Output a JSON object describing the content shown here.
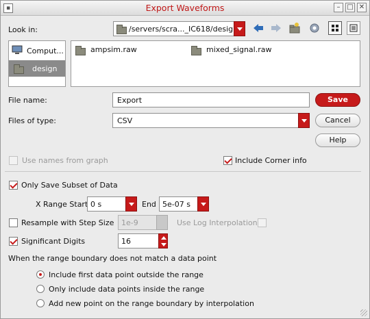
{
  "window": {
    "title": "Export Waveforms",
    "controls": [
      "minimize-icon",
      "maximize-icon",
      "close-icon"
    ]
  },
  "look_in": {
    "label": "Look in:",
    "value": "/servers/scra..._IC618/design"
  },
  "toolbar": {
    "icons": [
      "back-arrow-icon",
      "forward-arrow-icon",
      "new-folder-icon",
      "home-icon",
      "list-view-icon",
      "detail-view-icon"
    ]
  },
  "places": [
    {
      "label": "Comput...",
      "icon": "computer-icon",
      "selected": false
    },
    {
      "label": "design",
      "icon": "folder-icon",
      "selected": true
    }
  ],
  "files": [
    {
      "name": "ampsim.raw",
      "icon": "folder-icon"
    },
    {
      "name": "mixed_signal.raw",
      "icon": "folder-icon"
    }
  ],
  "file_name": {
    "label": "File name:",
    "value": "Export"
  },
  "files_of_type": {
    "label": "Files of type:",
    "value": "CSV"
  },
  "buttons": {
    "save": "Save",
    "cancel": "Cancel",
    "help": "Help"
  },
  "options": {
    "use_names": {
      "label": "Use names from graph",
      "checked": false,
      "enabled": false
    },
    "include_corner": {
      "label": "Include Corner info",
      "checked": true
    },
    "only_subset": {
      "label": "Only Save Subset of Data",
      "checked": true
    },
    "x_range_start": {
      "label": "X Range Start",
      "value": "0 s"
    },
    "end": {
      "label": "End",
      "value": "5e-07 s"
    },
    "resample": {
      "label": "Resample with Step Size",
      "checked": false,
      "value": "1e-9"
    },
    "log_interp": {
      "label": "Use Log Interpolation",
      "checked": false,
      "enabled": false
    },
    "sig_digits": {
      "label": "Significant Digits",
      "checked": true,
      "value": "16"
    }
  },
  "range_boundary": {
    "prompt": "When the range boundary does not match a data point",
    "choices": [
      {
        "label": "Include first data point outside the range",
        "selected": true
      },
      {
        "label": "Only include data points inside the range",
        "selected": false
      },
      {
        "label": "Add new point on the range boundary by interpolation",
        "selected": false
      }
    ]
  },
  "colors": {
    "accent": "#c61a1a",
    "title": "#c01818",
    "background": "#ebebeb"
  }
}
